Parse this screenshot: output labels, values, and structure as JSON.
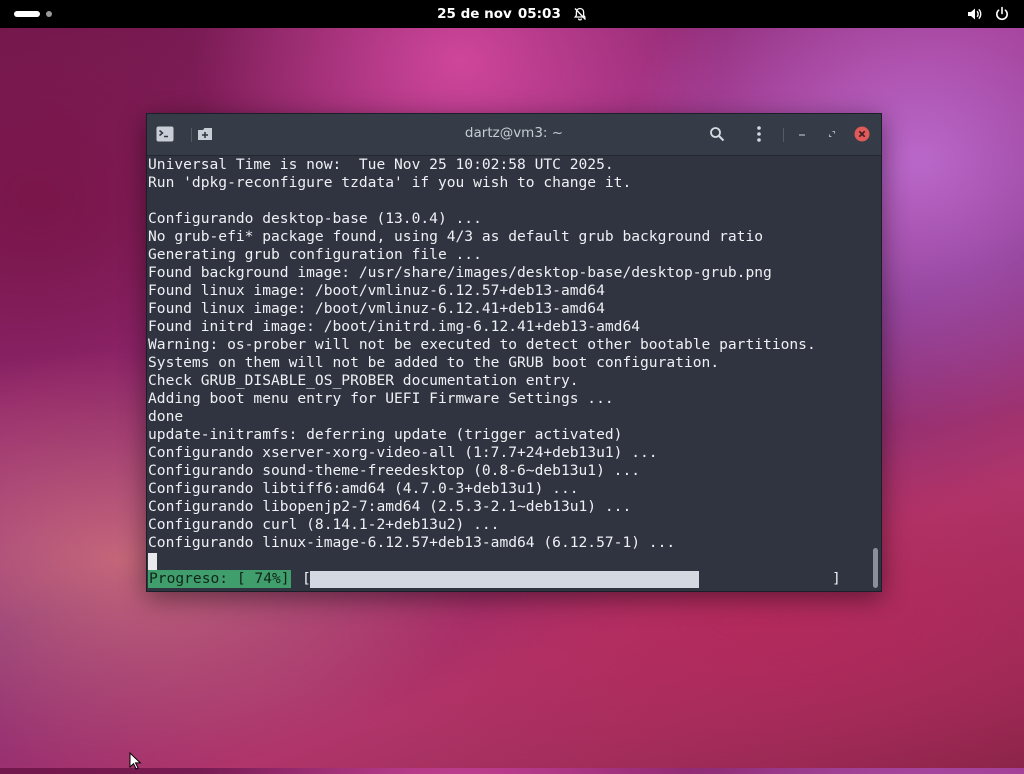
{
  "topbar": {
    "date": "25 de nov",
    "time": "05:03"
  },
  "icons": {
    "activities": "activities-indicator",
    "notifications": "bell-off-icon",
    "volume": "volume-icon",
    "power": "power-icon",
    "terminal": "terminal-icon",
    "new_tab": "new-tab-icon",
    "search": "search-icon",
    "menu": "kebab-menu-icon",
    "minimize": "minimize-icon",
    "maximize": "maximize-icon",
    "close": "close-icon"
  },
  "colors": {
    "close_button": "#e05a5a",
    "progress_label_bg": "#3f9e6b",
    "terminal_bg": "#2f3440"
  },
  "terminal": {
    "title": "dartz@vm3: ~",
    "lines": [
      "Universal Time is now:  Tue Nov 25 10:02:58 UTC 2025.",
      "Run 'dpkg-reconfigure tzdata' if you wish to change it.",
      "",
      "Configurando desktop-base (13.0.4) ...",
      "No grub-efi* package found, using 4/3 as default grub background ratio",
      "Generating grub configuration file ...",
      "Found background image: /usr/share/images/desktop-base/desktop-grub.png",
      "Found linux image: /boot/vmlinuz-6.12.57+deb13-amd64",
      "Found linux image: /boot/vmlinuz-6.12.41+deb13-amd64",
      "Found initrd image: /boot/initrd.img-6.12.41+deb13-amd64",
      "Warning: os-prober will not be executed to detect other bootable partitions.",
      "Systems on them will not be added to the GRUB boot configuration.",
      "Check GRUB_DISABLE_OS_PROBER documentation entry.",
      "Adding boot menu entry for UEFI Firmware Settings ...",
      "done",
      "update-initramfs: deferring update (trigger activated)",
      "Configurando xserver-xorg-video-all (1:7.7+24+deb13u1) ...",
      "Configurando sound-theme-freedesktop (0.8-6~deb13u1) ...",
      "Configurando libtiff6:amd64 (4.7.0-3+deb13u1) ...",
      "Configurando libopenjp2-7:amd64 (2.5.3-2.1~deb13u1) ...",
      "Configurando curl (8.14.1-2+deb13u2) ...",
      "Configurando linux-image-6.12.57+deb13-amd64 (6.12.57-1) ..."
    ],
    "progress": {
      "label": "Progreso: [ 74%]",
      "bracket_open": "[",
      "bracket_close": "]",
      "fraction": 0.74
    }
  }
}
